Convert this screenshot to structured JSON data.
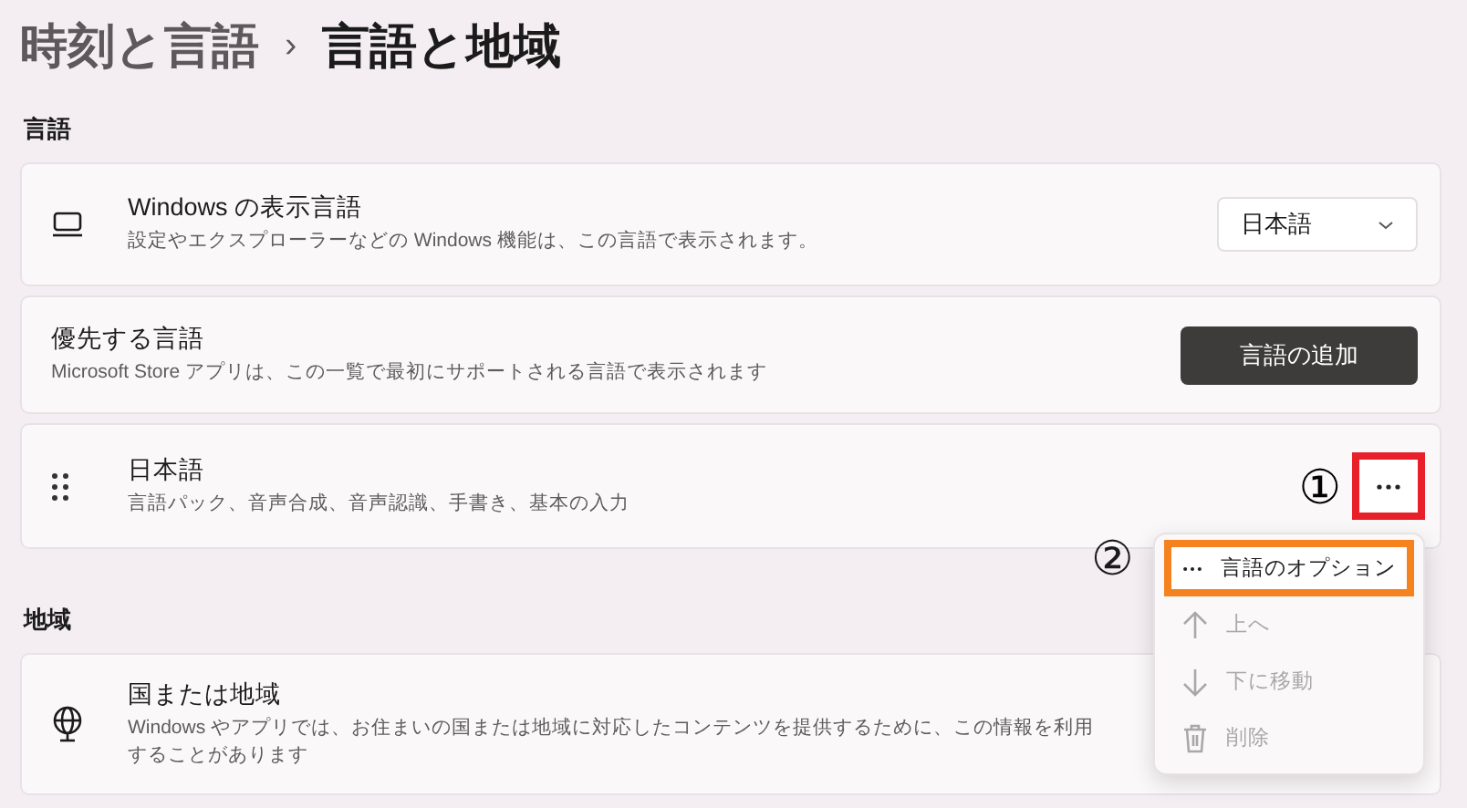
{
  "breadcrumb": {
    "parent": "時刻と言語",
    "separator": "›",
    "current": "言語と地域"
  },
  "sections": [
    {
      "heading": "言語",
      "cards": [
        {
          "kind": "dropdown",
          "title": "Windows の表示言語",
          "subtitle": "設定やエクスプローラーなどの Windows 機能は、この言語で表示されます。",
          "value": "日本語"
        },
        {
          "kind": "button",
          "title": "優先する言語",
          "subtitle": "Microsoft Store アプリは、この一覧で最初にサポートされる言語で表示されます",
          "button": "言語の追加"
        },
        {
          "kind": "language",
          "title": "日本語",
          "subtitle": "言語パック、音声合成、音声認識、手書き、基本の入力",
          "callout": "①",
          "outlined": true
        }
      ]
    },
    {
      "heading": "地域",
      "cards": [
        {
          "kind": "region",
          "title": "国または地域",
          "subtitle": "Windows やアプリでは、お住まいの国または地域に対応したコンテンツを提供するために、この情報を利用することがあります"
        }
      ]
    }
  ],
  "menu": {
    "callout": "②",
    "items": [
      {
        "kind": "options",
        "label": "言語のオプション",
        "disabled": false,
        "outlined": true
      },
      {
        "kind": "up",
        "label": "上へ",
        "disabled": true,
        "outlined": false
      },
      {
        "kind": "down",
        "label": "下に移動",
        "disabled": true,
        "outlined": false
      },
      {
        "kind": "delete",
        "label": "削除",
        "disabled": true,
        "outlined": false
      }
    ]
  }
}
